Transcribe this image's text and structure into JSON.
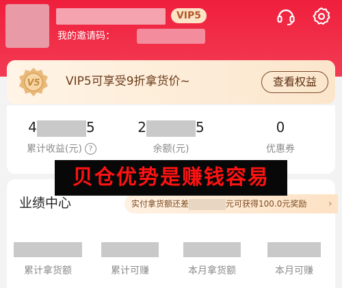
{
  "header": {
    "vip_badge": "VIP5",
    "invite_label": "我的邀请码："
  },
  "icons": {
    "support": "headset-icon",
    "settings": "gear-icon"
  },
  "vip_card": {
    "medal_text": "V5",
    "text": "VIP5可享受9折拿货价~",
    "button": "查看权益"
  },
  "stats": [
    {
      "value_start": "4",
      "value_end": "5",
      "label": "累计收益(元)"
    },
    {
      "value_start": "2",
      "value_end": "5",
      "label": "余额(元)"
    },
    {
      "value": "0",
      "label": "优惠券"
    }
  ],
  "banner": "贝仓优势是赚钱容易",
  "performance": {
    "title": "业绩中心",
    "tip_prefix": "实付拿货额还差",
    "tip_suffix": "元可获得100.0元奖励",
    "tip_arrow": "›",
    "items": [
      {
        "label": "累计拿货额"
      },
      {
        "label": "累计可赚"
      },
      {
        "label": "本月拿货额"
      },
      {
        "label": "本月可赚"
      }
    ]
  },
  "colors": {
    "header_red": "#ef1f3c",
    "vip_card_bg": "#fbe6cc",
    "banner_text": "#ff1212"
  }
}
